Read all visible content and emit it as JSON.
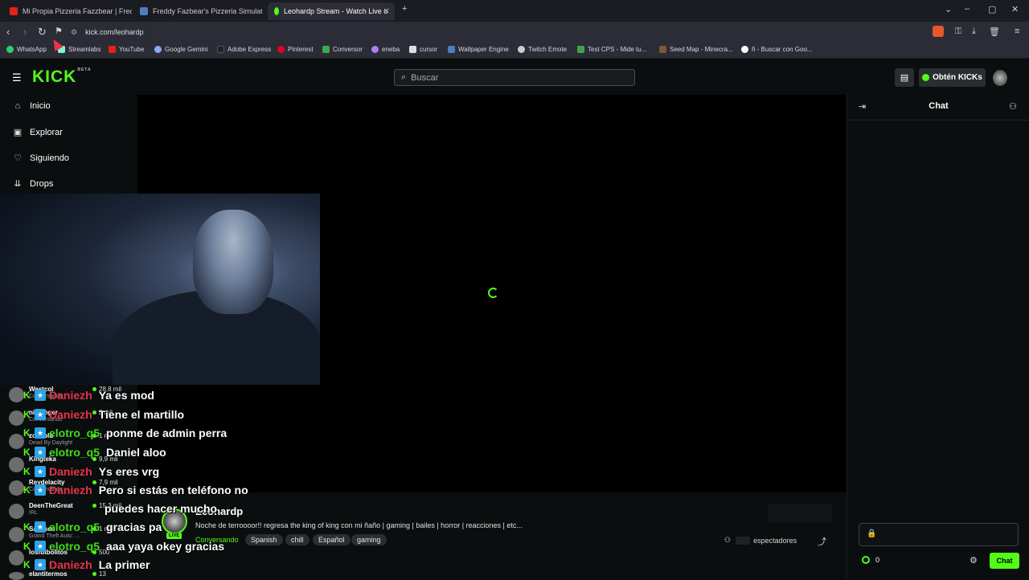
{
  "browser": {
    "tabs": [
      {
        "label": "Mi Propia Pizzeria Fazzbear | Freddy F",
        "color": "#e62117"
      },
      {
        "label": "Freddy Fazbear's Pizzeria Simulator e",
        "color": "#4a7fbf"
      },
      {
        "label": "Leohardp Stream - Watch Live o",
        "color": "#53fc18"
      }
    ],
    "new_tab": "+",
    "url": "kick.com/leohardp",
    "bookmarks": [
      {
        "label": "WhatsApp",
        "color": "#25d366"
      },
      {
        "label": "Streamlabs",
        "color": "#80f5d2"
      },
      {
        "label": "YouTube",
        "color": "#e62117"
      },
      {
        "label": "Google Gemini",
        "color": "#8aa9f5"
      },
      {
        "label": "Adobe Express",
        "color": "#222222"
      },
      {
        "label": "Pinterest",
        "color": "#e60023"
      },
      {
        "label": "Conversor",
        "color": "#3ea84a"
      },
      {
        "label": "eneba",
        "color": "#b07aff"
      },
      {
        "label": "cursor",
        "color": "#dddddd"
      },
      {
        "label": "Wallpaper Engine",
        "color": "#4a7fbf"
      },
      {
        "label": "Twitch Emote",
        "color": "#cccccc"
      },
      {
        "label": "Test CPS - Mide tu...",
        "color": "#3fa34d"
      },
      {
        "label": "Seed Map - Minecra...",
        "color": "#7b5a35"
      },
      {
        "label": "ñ - Buscar con Goo...",
        "color": "#ffffff"
      }
    ]
  },
  "header": {
    "logo": "KICK",
    "logo_beta": "BETA",
    "search_placeholder": "Buscar",
    "kicks_button": "Obtén KICKs"
  },
  "sidebar": {
    "items": [
      {
        "label": "Inicio",
        "icon": "⌂"
      },
      {
        "label": "Explorar",
        "icon": "▣"
      },
      {
        "label": "Siguiendo",
        "icon": "♡"
      },
      {
        "label": "Drops",
        "icon": "⇊"
      }
    ],
    "following": [
      {
        "name": "Westcol",
        "category": "Conversando",
        "viewers": "28,8 mil"
      },
      {
        "name": "nilfjenger",
        "category": "Conversando",
        "viewers": "2 mil"
      },
      {
        "name": "zokoblo",
        "category": "Dead By Daylight",
        "viewers": "1 mil"
      },
      {
        "name": "Kingteka",
        "category": "",
        "viewers": "9,9 mil"
      },
      {
        "name": "Reydelacity",
        "category": "Conversando",
        "viewers": "7,9 mil"
      },
      {
        "name": "DeenTheGreat",
        "category": "IRL",
        "viewers": "15,3 mil"
      },
      {
        "name": "Sasasen",
        "category": "Grand Theft Auto: ...",
        "viewers": "1 mil"
      },
      {
        "name": "losfutbolitos",
        "category": "",
        "viewers": "500"
      },
      {
        "name": "elantitermos",
        "category": "",
        "viewers": "13"
      }
    ]
  },
  "chat_overlay": [
    {
      "user": "Daniezh",
      "msg": "Ya es mod",
      "color": "red"
    },
    {
      "user": "Daniezh",
      "msg": "Tiene el martillo",
      "color": "red"
    },
    {
      "user": "elotro_q5",
      "msg": "ponme de admin perra",
      "color": "green"
    },
    {
      "user": "elotro_q5",
      "msg": "Daniel aloo",
      "color": "green"
    },
    {
      "user": "Daniezh",
      "msg": "Ys eres vrg",
      "color": "red"
    },
    {
      "user": "Daniezh",
      "msg": "Pero si estás en teléfono no",
      "color": "red"
    },
    {
      "user": "",
      "msg": "puedes hacer mucho",
      "color": "red"
    },
    {
      "user": "elotro_q5",
      "msg": "gracias pa",
      "color": "green"
    },
    {
      "user": "elotro_q5",
      "msg": "aaa yaya okey gracias",
      "color": "green"
    },
    {
      "user": "Daniezh",
      "msg": "La primer",
      "color": "red"
    }
  ],
  "stream": {
    "streamer": "Leohardp",
    "title": "Noche de terroooor!! regresa the king of king con mi ñaño | gaming | bailes | horror | reacciones | etc...",
    "category": "Conversando",
    "tags": [
      "Spanish",
      "chill",
      "Español",
      "gaming"
    ],
    "viewers_label": "espectadores",
    "live": "LIVE"
  },
  "chat": {
    "title": "Chat",
    "send_button": "Chat",
    "kicks_count": "0"
  },
  "colors": {
    "brand": "#53fc18",
    "background": "#0b0e0f"
  }
}
